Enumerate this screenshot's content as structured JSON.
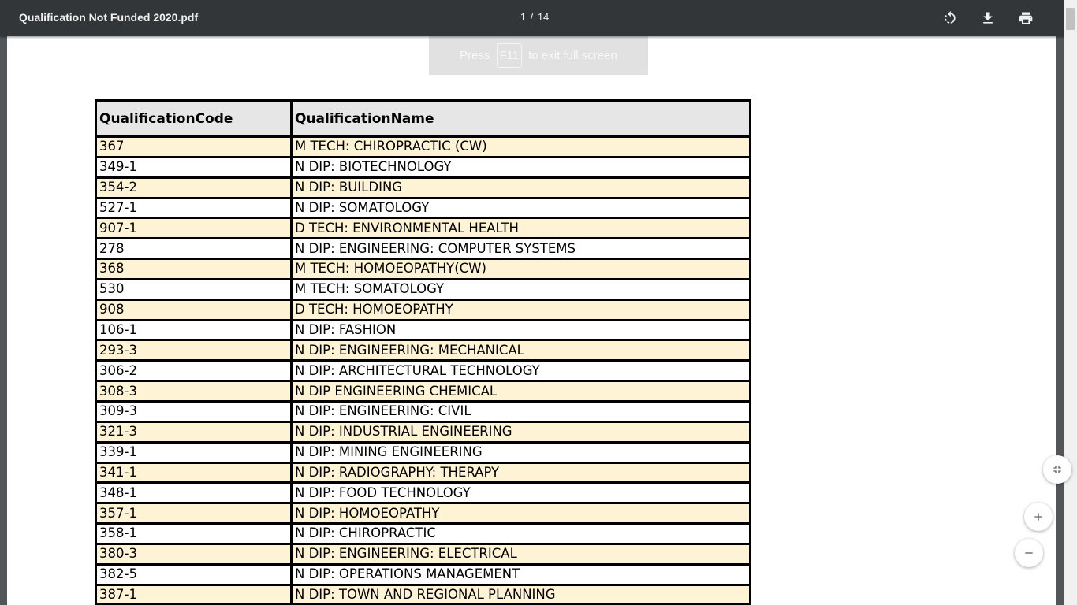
{
  "toolbar": {
    "title": "Qualification Not Funded 2020.pdf",
    "current_page": "1",
    "page_separator": "/",
    "total_pages": "14",
    "rotate_icon": "rotate-icon",
    "download_icon": "download-icon",
    "print_icon": "print-icon"
  },
  "fullscreen_hint": {
    "prefix": "Press",
    "key": "F11",
    "suffix": "to exit full screen"
  },
  "table": {
    "headers": [
      "QualificationCode",
      "QualificationName"
    ],
    "rows": [
      [
        "367",
        "M TECH:  CHIROPRACTIC (CW)"
      ],
      [
        "349-1",
        "N DIP: BIOTECHNOLOGY"
      ],
      [
        "354-2",
        "N DIP: BUILDING"
      ],
      [
        "527-1",
        "N DIP:  SOMATOLOGY"
      ],
      [
        "907-1",
        "D TECH:  ENVIRONMENTAL HEALTH"
      ],
      [
        "278",
        "N DIP: ENGINEERING: COMPUTER SYSTEMS"
      ],
      [
        "368",
        "M TECH:  HOMOEOPATHY(CW)"
      ],
      [
        "530",
        "M TECH: SOMATOLOGY"
      ],
      [
        "908",
        "D TECH:  HOMOEOPATHY"
      ],
      [
        "106-1",
        "N DIP: FASHION"
      ],
      [
        "293-3",
        "N DIP: ENGINEERING: MECHANICAL"
      ],
      [
        "306-2",
        "N DIP: ARCHITECTURAL TECHNOLOGY"
      ],
      [
        "308-3",
        "N DIP ENGINEERING CHEMICAL"
      ],
      [
        "309-3",
        "N DIP: ENGINEERING: CIVIL"
      ],
      [
        "321-3",
        "N DIP:  INDUSTRIAL ENGINEERING"
      ],
      [
        "339-1",
        "N DIP: MINING ENGINEERING"
      ],
      [
        "341-1",
        "N DIP: RADIOGRAPHY: THERAPY"
      ],
      [
        "348-1",
        "N DIP: FOOD TECHNOLOGY"
      ],
      [
        "357-1",
        "N DIP:  HOMOEOPATHY"
      ],
      [
        "358-1",
        "N DIP: CHIROPRACTIC"
      ],
      [
        "380-3",
        "N DIP: ENGINEERING: ELECTRICAL"
      ],
      [
        "382-5",
        "N DIP: OPERATIONS MANAGEMENT"
      ],
      [
        "387-1",
        "N DIP: TOWN AND REGIONAL PLANNING"
      ]
    ],
    "alt_row_color": "#fff3d6",
    "header_bg_color": "#e6e6e6"
  },
  "zoom_controls": {
    "fit_icon": "fit-to-page-icon",
    "zoom_in_icon": "zoom-in-icon",
    "zoom_out_icon": "zoom-out-icon"
  },
  "colors": {
    "toolbar_bg": "#323639",
    "viewer_bg": "#525659",
    "page_bg": "#ffffff"
  }
}
